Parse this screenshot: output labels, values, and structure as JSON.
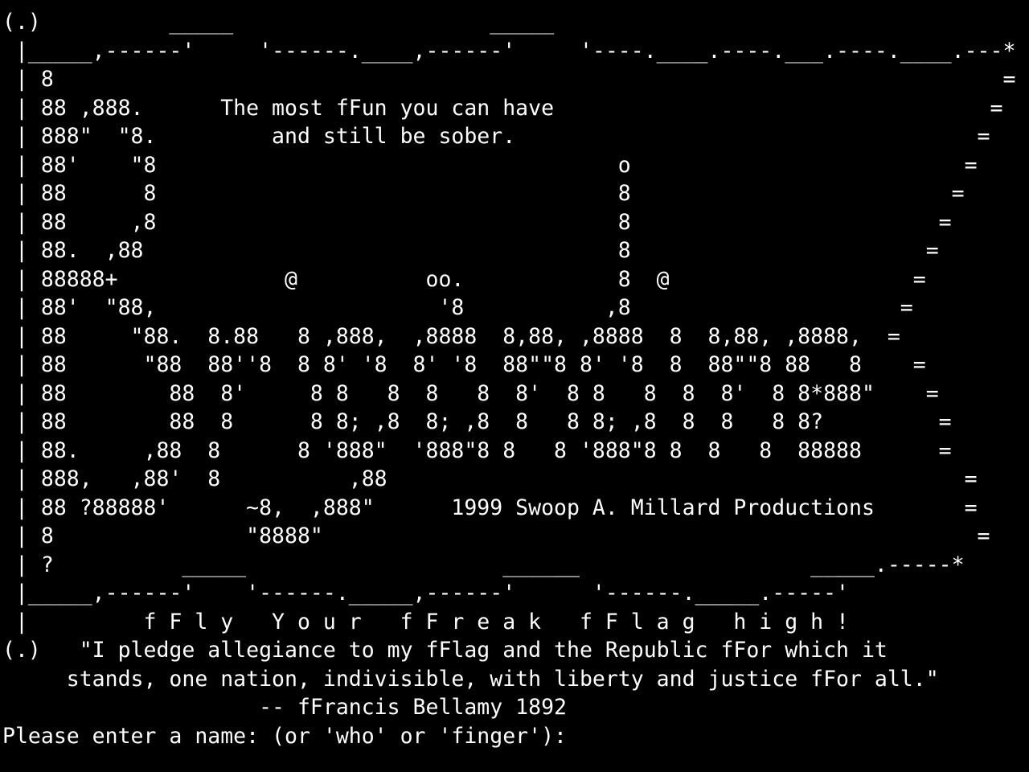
{
  "terminal": {
    "background": "#000000",
    "foreground": "#ffffff",
    "banner_lines": [
      "(.)          _____                    _____",
      " |_____,------'     '------.____,------'     '----.____.----.___.----.____.---*",
      " | 8                                                                          =",
      " | 88 ,888.      The most fFun you can have                                  =",
      " | 888\"  \"8.         and still be sober.                                    =",
      " | 88'    \"8                                    o                          =",
      " | 88      8                                    8                         =",
      " | 88     ,8                                    8                        =",
      " | 88.  ,88                                     8                       =",
      " | 88888+             @          oo.            8  @                   =",
      " | 88'  \"88,                      '8           ,8                     =",
      " | 88     \"88.  8.88   8 ,888,  ,8888  8,88, ,8888  8  8,88, ,8888,  =",
      " | 88      \"88  88''8  8 8' '8  8' '8  88\"\"8 8' '8  8  88\"\"8 88   8    =",
      " | 88        88  8'     8 8   8  8   8  8'  8 8   8  8  8'  8 8*888\"    =",
      " | 88        88  8      8 8; ,8  8; ,8  8   8 8; ,8  8  8   8 8?         =",
      " | 88.     ,88  8      8 '888\"  '888\"8 8   8 '888\"8 8  8   8  88888      =",
      " | 888,   ,88'  8          ,88                                             =",
      " | 88 ?88888'      ~8,  ,888\"      1999 Swoop A. Millard Productions       =",
      " | 8               \"8888\"                                                   =",
      " | ?          _____                    ______                  _____.-----*",
      " |_____,------'    '------._____,------'      '------._____.-----'",
      " |         f F l y   Y o u r   f F r e a k   f F l a g   h i g h !",
      "(.)   \"I pledge allegiance to my fFlag and the Republic fFor which it",
      "     stands, one nation, indivisible, with liberty and justice fFor all.\"",
      "                    -- fFrancis Bellamy 1892"
    ],
    "prompt": {
      "label": "Please enter a name: (or 'who' or 'finger'): ",
      "value": ""
    }
  }
}
